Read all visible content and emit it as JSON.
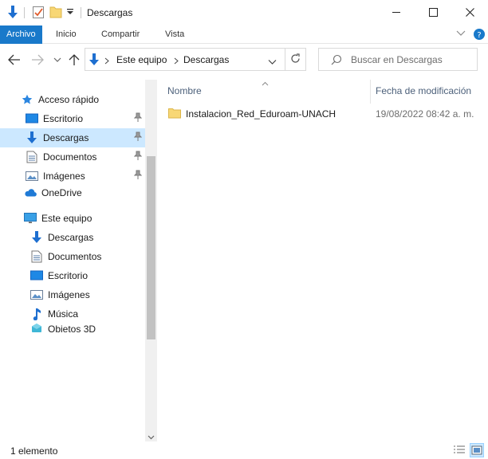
{
  "window": {
    "title": "Descargas",
    "quick_access_icons": [
      "download-arrow-icon",
      "properties-checklist-icon",
      "new-folder-icon",
      "customize-dropdown-icon"
    ]
  },
  "ribbon": {
    "tabs": [
      {
        "label": "Archivo",
        "active": true
      },
      {
        "label": "Inicio",
        "active": false
      },
      {
        "label": "Compartir",
        "active": false
      },
      {
        "label": "Vista",
        "active": false
      }
    ]
  },
  "address": {
    "parts": [
      "Este equipo",
      "Descargas"
    ]
  },
  "search": {
    "placeholder": "Buscar en Descargas"
  },
  "sidebar": {
    "quick_access_label": "Acceso rápido",
    "quick_access": [
      {
        "label": "Escritorio",
        "icon": "desktop-icon",
        "pinned": true
      },
      {
        "label": "Descargas",
        "icon": "downloads-icon",
        "pinned": true,
        "selected": true
      },
      {
        "label": "Documentos",
        "icon": "documents-icon",
        "pinned": true
      },
      {
        "label": "Imágenes",
        "icon": "pictures-icon",
        "pinned": true
      }
    ],
    "onedrive_label": "OneDrive",
    "this_pc_label": "Este equipo",
    "this_pc": [
      {
        "label": "Descargas",
        "icon": "downloads-icon"
      },
      {
        "label": "Documentos",
        "icon": "documents-icon"
      },
      {
        "label": "Escritorio",
        "icon": "desktop-icon"
      },
      {
        "label": "Imágenes",
        "icon": "pictures-icon"
      },
      {
        "label": "Música",
        "icon": "music-icon"
      },
      {
        "label": "Objetos 3D",
        "icon": "3d-objects-icon"
      }
    ]
  },
  "files": {
    "columns": {
      "name": "Nombre",
      "modified": "Fecha de modificación"
    },
    "items": [
      {
        "name": "Instalacion_Red_Eduroam-UNACH",
        "modified": "19/08/2022 08:42 a. m.",
        "icon": "folder-icon"
      }
    ]
  },
  "status": {
    "item_count": "1 elemento"
  },
  "colors": {
    "accent": "#1979ca",
    "selection": "#cce8ff",
    "folder": "#f8d775"
  }
}
